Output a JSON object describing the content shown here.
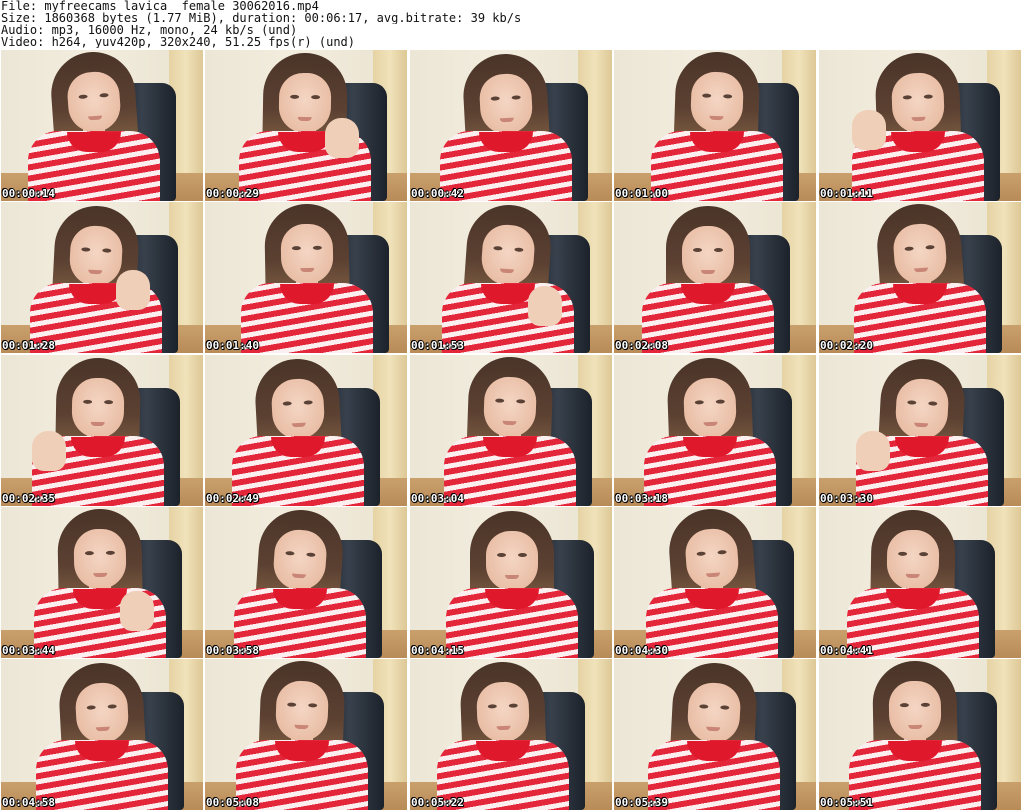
{
  "header": {
    "line1": "File: myfreecams_lavica__female_30062016.mp4",
    "line2": "Size: 1860368 bytes (1.77 MiB), duration: 00:06:17, avg.bitrate: 39 kb/s",
    "line3": "Audio: mp3, 16000 Hz, mono, 24 kb/s (und)",
    "line4": "Video: h264, yuv420p, 320x240, 51.25 fps(r) (und)"
  },
  "thumbnails": [
    {
      "time": "00:00:14",
      "hand": false
    },
    {
      "time": "00:00:29",
      "hand": true
    },
    {
      "time": "00:00:42",
      "hand": false
    },
    {
      "time": "00:01:00",
      "hand": false
    },
    {
      "time": "00:01:11",
      "hand": true
    },
    {
      "time": "00:01:28",
      "hand": true
    },
    {
      "time": "00:01:40",
      "hand": false
    },
    {
      "time": "00:01:53",
      "hand": true
    },
    {
      "time": "00:02:08",
      "hand": false
    },
    {
      "time": "00:02:20",
      "hand": false
    },
    {
      "time": "00:02:35",
      "hand": true
    },
    {
      "time": "00:02:49",
      "hand": false
    },
    {
      "time": "00:03:04",
      "hand": false
    },
    {
      "time": "00:03:18",
      "hand": false
    },
    {
      "time": "00:03:30",
      "hand": true
    },
    {
      "time": "00:03:44",
      "hand": true
    },
    {
      "time": "00:03:58",
      "hand": false
    },
    {
      "time": "00:04:15",
      "hand": false
    },
    {
      "time": "00:04:30",
      "hand": false
    },
    {
      "time": "00:04:41",
      "hand": false
    },
    {
      "time": "00:04:58",
      "hand": false
    },
    {
      "time": "00:05:08",
      "hand": false
    },
    {
      "time": "00:05:22",
      "hand": false
    },
    {
      "time": "00:05:39",
      "hand": false
    },
    {
      "time": "00:05:51",
      "hand": false
    }
  ]
}
